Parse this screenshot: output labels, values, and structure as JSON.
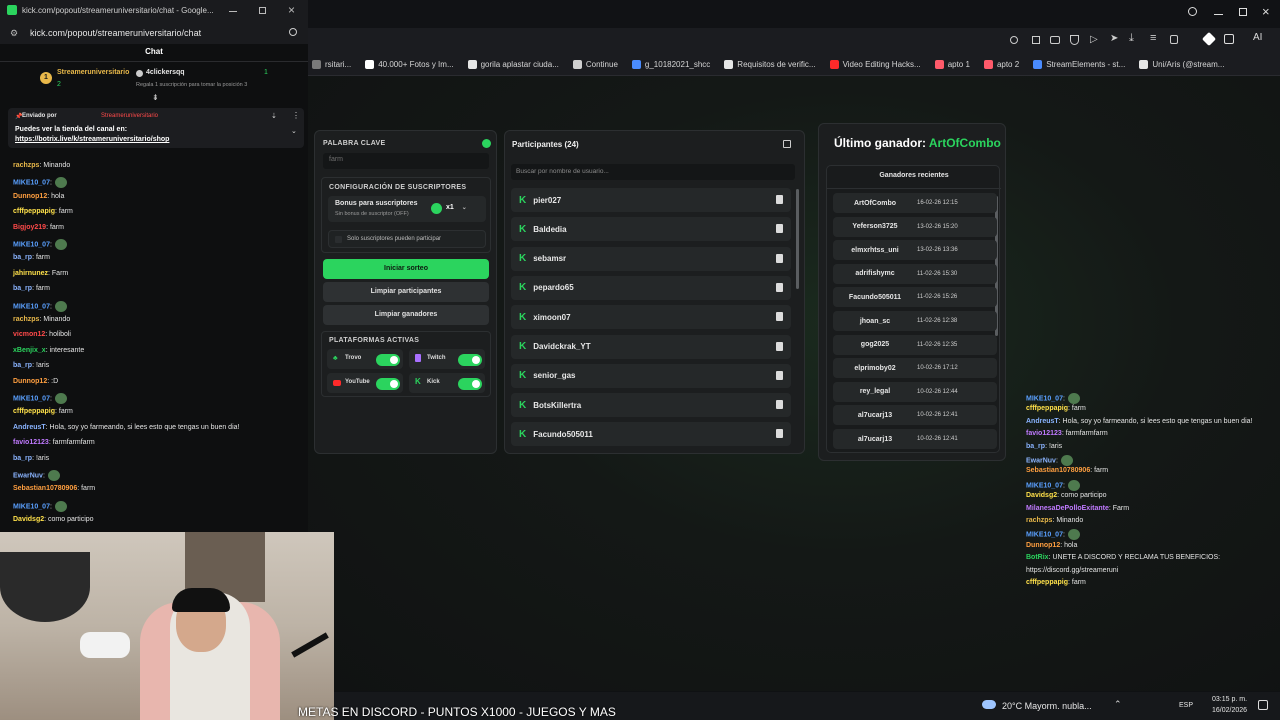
{
  "chat_window": {
    "url": "kick.com/popout/streameruniversitario/chat",
    "title": "kick.com/popout/streameruniversitario/chat - Google...",
    "header": "Chat",
    "leaderboard": {
      "first_rank": "1",
      "first_name": "Streameruniversitario",
      "first_count": "2",
      "second_name": "4clickersqq",
      "second_rank": "1",
      "note": "Regala 1 suscripción para tomar la posición 3"
    },
    "pinned": {
      "sent_by": "Enviado por",
      "author": "Streameruniversitario",
      "line1": "Puedes ver la tienda del canal en:",
      "link": "https://botrix.live/k/streameruniversitario/shop"
    },
    "messages": [
      {
        "user": "rachzps",
        "text": ": Minando",
        "color": "#e8b84a",
        "emote": false
      },
      {
        "user": "MIKE10_07",
        "text": ":",
        "color": "#5aa0ff",
        "emote": true
      },
      {
        "user": "Dunnop12",
        "text": ": hola",
        "color": "#ff9f40",
        "emote": false
      },
      {
        "user": "cfffpeppapig",
        "text": ": farm",
        "color": "#ffe14a",
        "emote": false
      },
      {
        "user": "Bigjoy219",
        "text": ": farm",
        "color": "#ff4a4a",
        "emote": false
      },
      {
        "user": "MIKE10_07",
        "text": ":",
        "color": "#5aa0ff",
        "emote": true
      },
      {
        "user": "ba_rp",
        "text": ": farm",
        "color": "#8ab4ff",
        "emote": false
      },
      {
        "user": "jahirnunez",
        "text": ": Farm",
        "color": "#ffe14a",
        "emote": false
      },
      {
        "user": "ba_rp",
        "text": ": farm",
        "color": "#8ab4ff",
        "emote": false
      },
      {
        "user": "MIKE10_07",
        "text": ":",
        "color": "#5aa0ff",
        "emote": true
      },
      {
        "user": "rachzps",
        "text": ": Minando",
        "color": "#e8b84a",
        "emote": false
      },
      {
        "user": "vicmon12",
        "text": ": holiboli",
        "color": "#ff4a4a",
        "emote": false
      },
      {
        "user": "xBenjix_x",
        "text": ": interesante",
        "color": "#2bd45e",
        "emote": false
      },
      {
        "user": "ba_rp",
        "text": ": !aris",
        "color": "#8ab4ff",
        "emote": false
      },
      {
        "user": "Dunnop12",
        "text": ": :D",
        "color": "#ff9f40",
        "emote": false
      },
      {
        "user": "MIKE10_07",
        "text": ":",
        "color": "#5aa0ff",
        "emote": true
      },
      {
        "user": "cfffpeppapig",
        "text": ": farm",
        "color": "#ffe14a",
        "emote": false
      },
      {
        "user": "AndreusT",
        "text": ": Hola, soy yo farmeando, si lees esto que tengas un buen dia!",
        "color": "#8ab4ff",
        "emote": false
      },
      {
        "user": "favio12123",
        "text": ": farmfarmfarm",
        "color": "#c07aff",
        "emote": false
      },
      {
        "user": "ba_rp",
        "text": ": !aris",
        "color": "#8ab4ff",
        "emote": false
      },
      {
        "user": "EwarNuv",
        "text": ":",
        "color": "#8ab4ff",
        "emote": true
      },
      {
        "user": "Sebastian10780906",
        "text": ": farm",
        "color": "#ff9f40",
        "emote": false
      },
      {
        "user": "MIKE10_07",
        "text": ":",
        "color": "#5aa0ff",
        "emote": true
      },
      {
        "user": "Davidsg2",
        "text": ": como participo",
        "color": "#ffe14a",
        "emote": false
      }
    ]
  },
  "bookmarks": [
    {
      "label": "rsitari...",
      "color": "#7a7a7a"
    },
    {
      "label": "40.000+ Fotos y Im...",
      "color": "#ffffff"
    },
    {
      "label": "gorila aplastar ciuda...",
      "color": "#e6e6e6"
    },
    {
      "label": "Continue",
      "color": "#cfcfcf"
    },
    {
      "label": "g_10182021_shcc",
      "color": "#4a8cff"
    },
    {
      "label": "Requisitos de verific...",
      "color": "#e6e6e6"
    },
    {
      "label": "Video Editing Hacks...",
      "color": "#ff2a2a"
    },
    {
      "label": "apto 1",
      "color": "#ff5a6a"
    },
    {
      "label": "apto 2",
      "color": "#ff5a6a"
    },
    {
      "label": "StreamElements - st...",
      "color": "#4a8cff"
    },
    {
      "label": "Uni/Aris (@stream...",
      "color": "#e6e6e6"
    }
  ],
  "settings": {
    "keyword_title": "PALABRA CLAVE",
    "keyword_value": "farm",
    "subs_title": "CONFIGURACIÓN DE SUSCRIPTORES",
    "bonus_label": "Bonus para suscriptores",
    "bonus_sub": "Sin bonus de suscriptor (OFF)",
    "bonus_mult": "x1",
    "subs_only": "Solo suscriptores pueden participar",
    "start_btn": "Iniciar sorteo",
    "clear_participants": "Limpiar participantes",
    "clear_winners": "Limpiar ganadores",
    "platforms_title": "PLATAFORMAS ACTIVAS",
    "platforms": [
      "Trovo",
      "Twitch",
      "YouTube",
      "Kick"
    ]
  },
  "participants": {
    "title": "Participantes (24)",
    "search_placeholder": "Buscar por nombre de usuario...",
    "list": [
      "pier027",
      "Baldedia",
      "sebamsr",
      "pepardo65",
      "ximoon07",
      "Davidckrak_YT",
      "senior_gas",
      "BotsKillertra",
      "Facundo505011"
    ]
  },
  "winners": {
    "title": "Último ganador:",
    "last_winner": "ArtOfCombo",
    "recent_title": "Ganadores recientes",
    "list": [
      {
        "name": "ArtOfCombo",
        "date": "16-02-26 12:15"
      },
      {
        "name": "Yeferson3725",
        "date": "13-02-26 15:20"
      },
      {
        "name": "elmxrhtss_uni",
        "date": "13-02-26 13:36"
      },
      {
        "name": "adrifishymc",
        "date": "11-02-26 15:30"
      },
      {
        "name": "Facundo505011",
        "date": "11-02-26 15:26"
      },
      {
        "name": "jhoan_sc",
        "date": "11-02-26 12:38"
      },
      {
        "name": "gog2025",
        "date": "11-02-26 12:35"
      },
      {
        "name": "elprimoby02",
        "date": "10-02-26 17:12"
      },
      {
        "name": "rey_legal",
        "date": "10-02-26 12:44"
      },
      {
        "name": "al7ucarj13",
        "date": "10-02-26 12:41"
      },
      {
        "name": "al7ucarj13",
        "date": "10-02-26 12:41"
      }
    ]
  },
  "overlay_chat": [
    {
      "user": "MIKE10_07",
      "text": ":",
      "color": "#5aa0ff",
      "emote": true
    },
    {
      "user": "cfffpeppapig",
      "text": ": farm",
      "color": "#ffe14a",
      "emote": false
    },
    {
      "user": "AndreusT",
      "text": ": Hola, soy yo farmeando, si lees esto que tengas un buen dia!",
      "color": "#8ab4ff",
      "emote": false
    },
    {
      "user": "favio12123",
      "text": ": farmfarmfarm",
      "color": "#c07aff",
      "emote": false
    },
    {
      "user": "ba_rp",
      "text": ": !aris",
      "color": "#8ab4ff",
      "emote": false
    },
    {
      "user": "EwarNuv",
      "text": ":",
      "color": "#8ab4ff",
      "emote": true
    },
    {
      "user": "Sebastian10780906",
      "text": ": farm",
      "color": "#ff9f40",
      "emote": false
    },
    {
      "user": "MIKE10_07",
      "text": ":",
      "color": "#5aa0ff",
      "emote": true
    },
    {
      "user": "Davidsg2",
      "text": ": como participo",
      "color": "#ffe14a",
      "emote": false
    },
    {
      "user": "MilanesaDePolloExitante",
      "text": ": Farm",
      "color": "#c07aff",
      "emote": false
    },
    {
      "user": "rachzps",
      "text": ": Minando",
      "color": "#e8b84a",
      "emote": false
    },
    {
      "user": "MIKE10_07",
      "text": ":",
      "color": "#5aa0ff",
      "emote": true
    },
    {
      "user": "Dunnop12",
      "text": ": hola",
      "color": "#ff9f40",
      "emote": false
    },
    {
      "user": "BotRix",
      "text": ": UNETE A DISCORD Y RECLAMA TUS BENEFICIOS:",
      "color": "#2bd45e",
      "emote": false
    },
    {
      "user": "",
      "text": "https://discord.gg/streameruni",
      "color": "#e4e4e4",
      "emote": false
    },
    {
      "user": "cfffpeppapig",
      "text": ": farm",
      "color": "#ffe14a",
      "emote": false
    }
  ],
  "ticker": "METAS EN DISCORD - PUNTOS X1000 - JUEGOS Y MAS",
  "taskbar": {
    "weather": "20°C Mayorm. nubla...",
    "lang": "ESP",
    "time": "03:15 p. m.",
    "date": "16/02/2026"
  },
  "accent": "#2bd45e"
}
